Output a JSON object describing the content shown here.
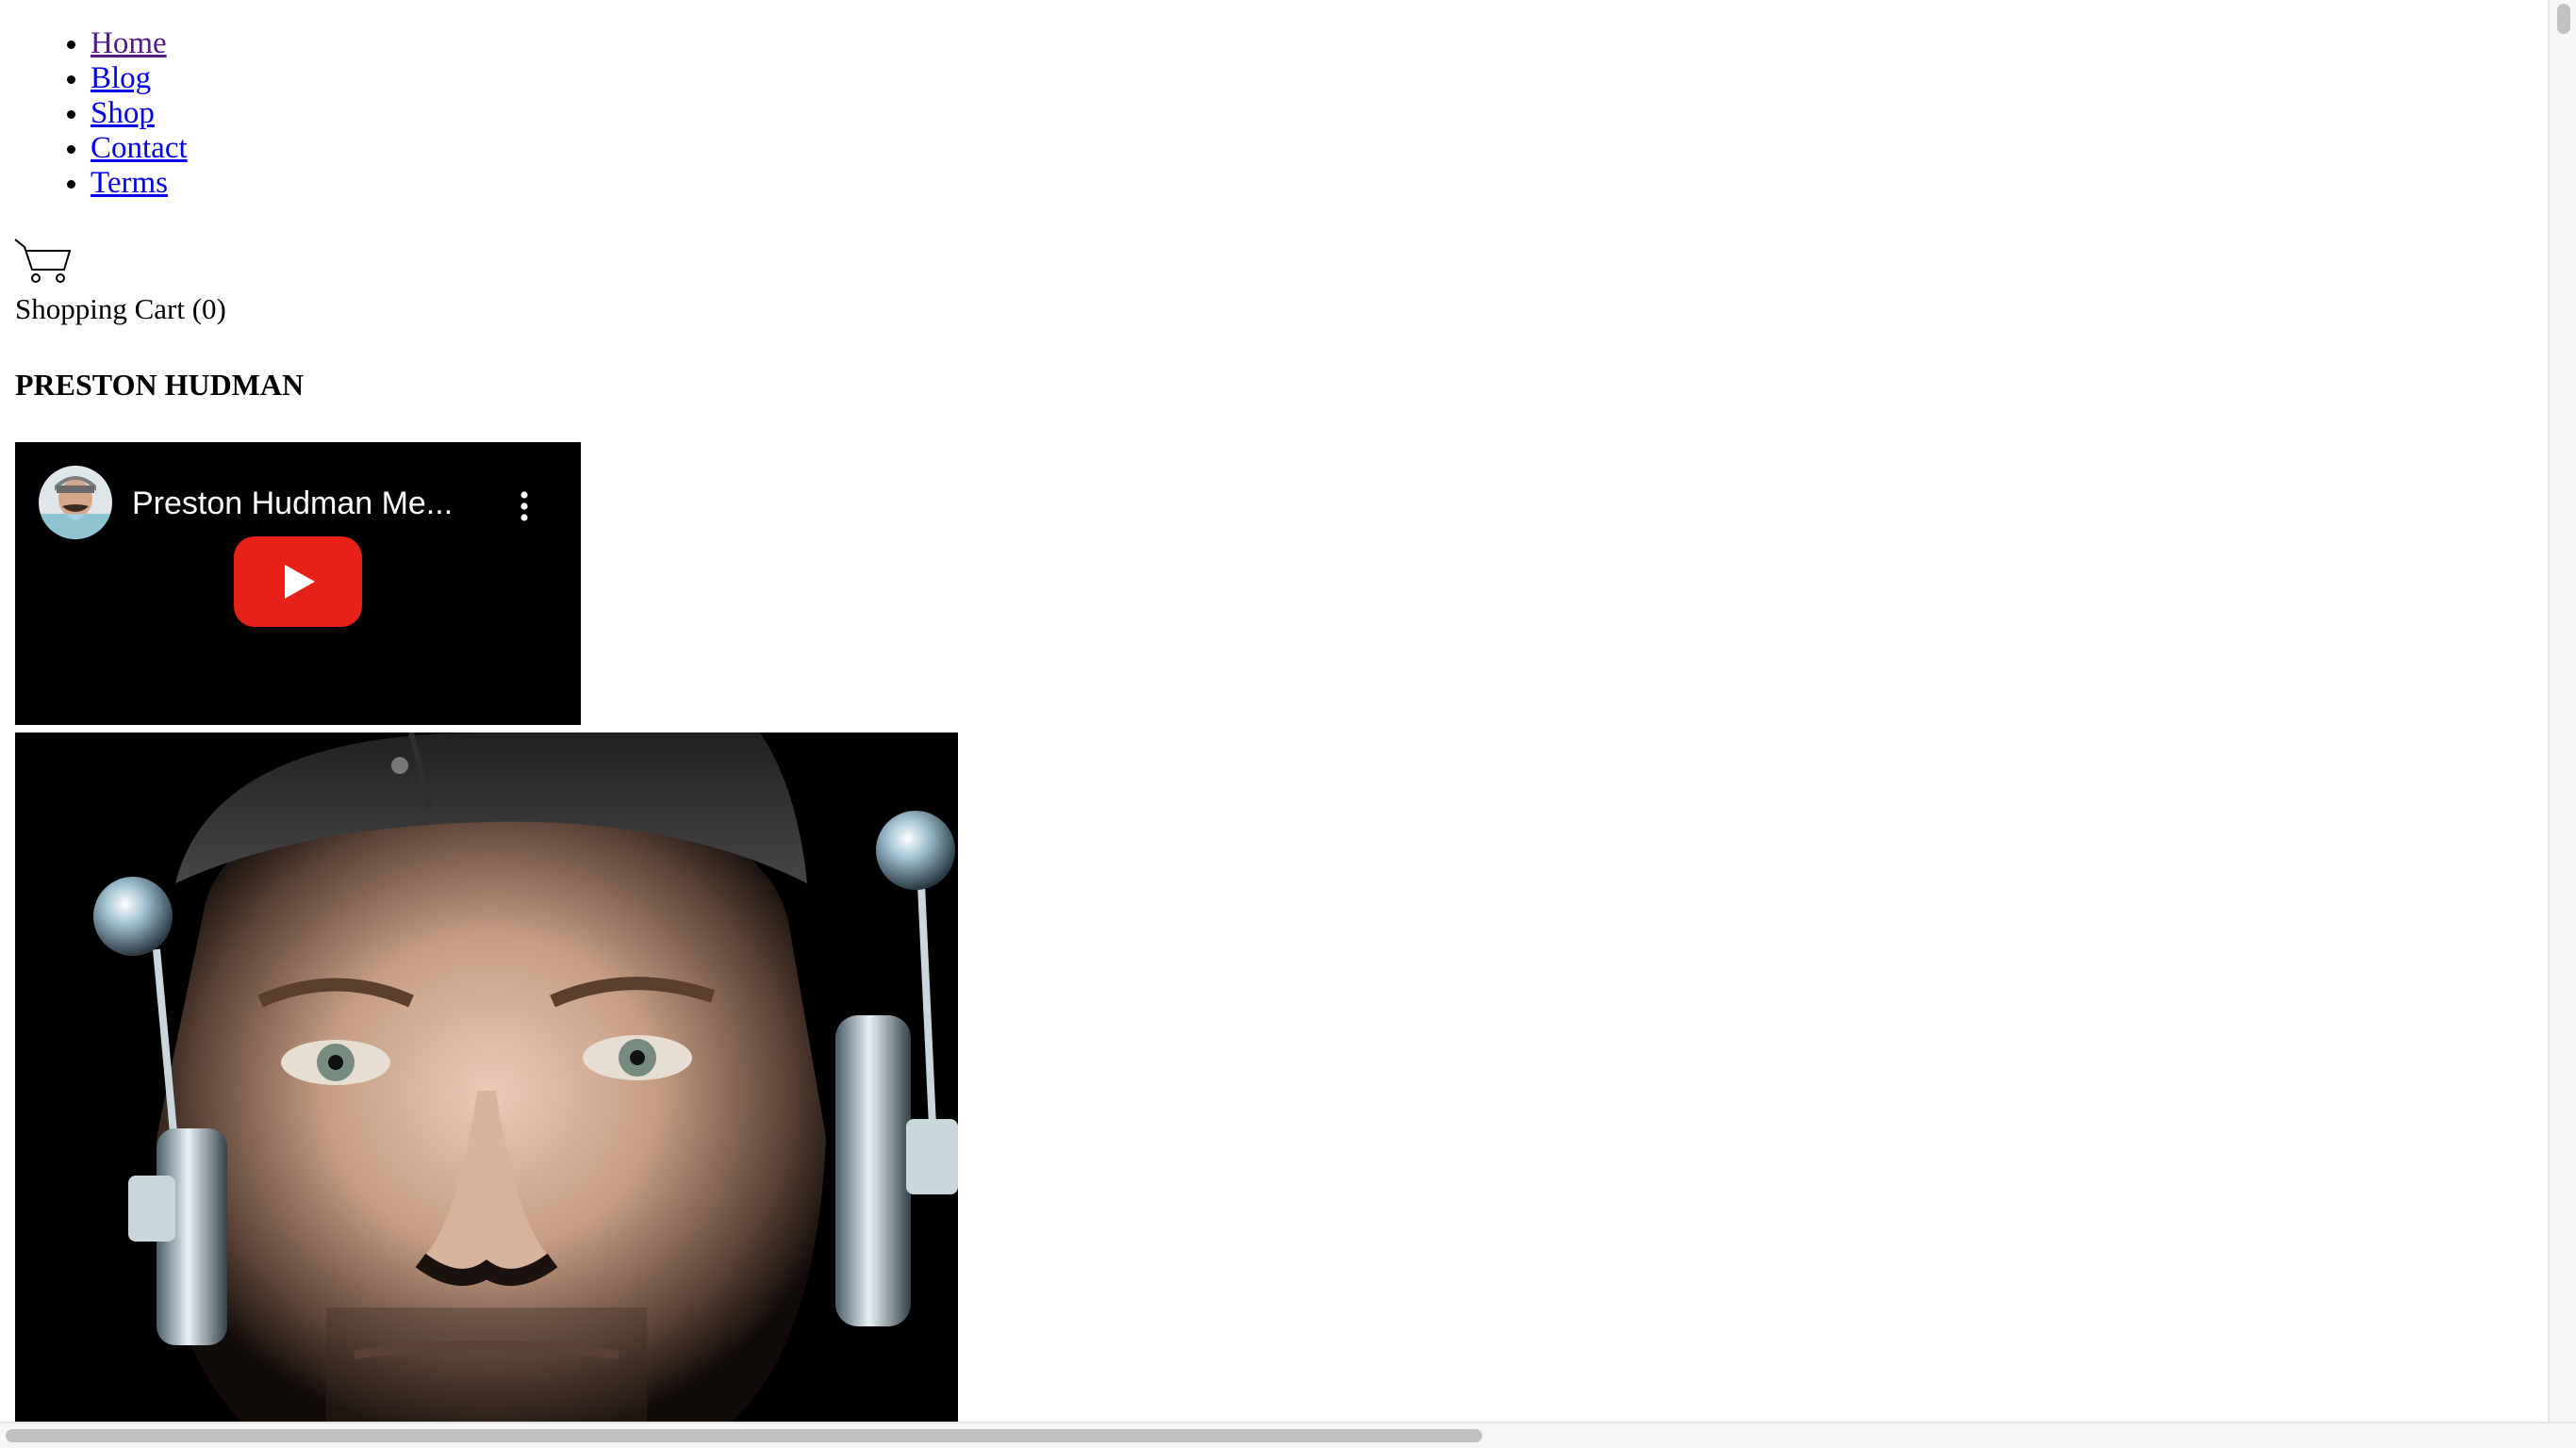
{
  "nav": {
    "items": [
      {
        "label": "Home"
      },
      {
        "label": "Blog"
      },
      {
        "label": "Shop"
      },
      {
        "label": "Contact"
      },
      {
        "label": "Terms"
      }
    ]
  },
  "cart": {
    "icon": "shopping-cart-icon",
    "label": "Shopping Cart (0)"
  },
  "site": {
    "title": "PRESTON HUDMAN"
  },
  "video": {
    "title": "Preston Hudman Me...",
    "channel_icon": "channel-avatar-icon",
    "menu_icon": "more-vertical-icon",
    "play_icon": "youtube-play-icon",
    "play_color": "#e62117"
  },
  "photo": {
    "subject": "portrait-photo"
  }
}
